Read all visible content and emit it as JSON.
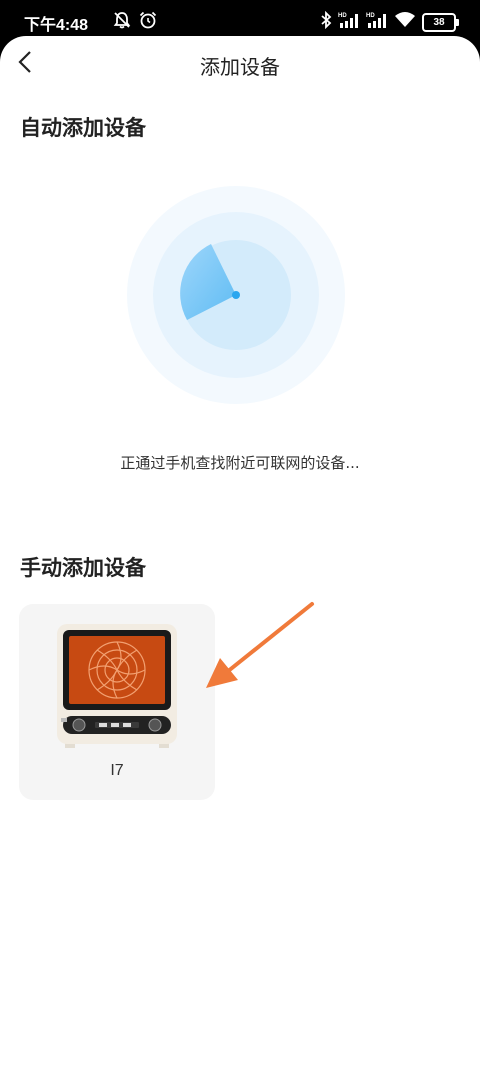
{
  "status_bar": {
    "time": "下午4:48",
    "icons": [
      "mute-bell-icon",
      "alarm-icon",
      "bluetooth-icon",
      "hd-signal-icon",
      "hd-signal-icon",
      "wifi-icon"
    ],
    "battery": "38"
  },
  "header": {
    "title": "添加设备",
    "back_icon": "back-chevron-icon"
  },
  "auto_section": {
    "title": "自动添加设备",
    "scanning_text": "正通过手机查找附近可联网的设备...",
    "accent_color": "#2aa6ef"
  },
  "manual_section": {
    "title": "手动添加设备",
    "devices": [
      {
        "name": "I7",
        "icon": "oven-image"
      }
    ]
  },
  "annotation": {
    "arrow_color": "#f07a3a"
  }
}
